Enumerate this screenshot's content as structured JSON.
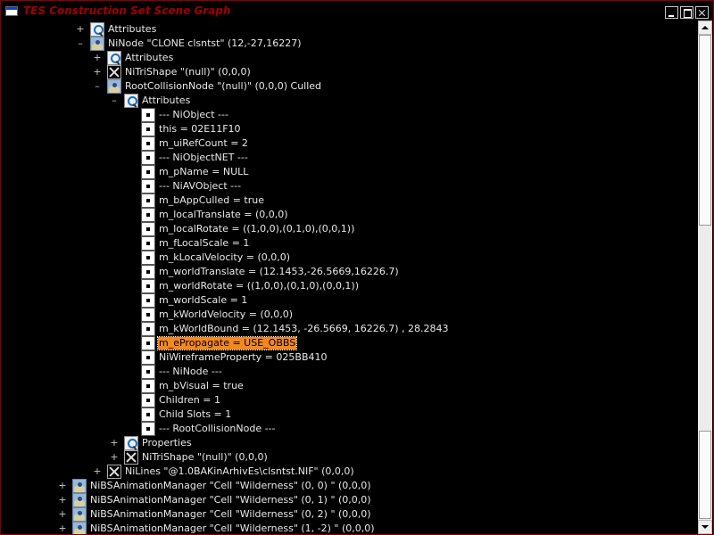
{
  "window": {
    "title": "TES Construction Set Scene Graph"
  },
  "tree": {
    "rows": [
      {
        "expander": "+",
        "icon": "attributes-icon",
        "label": "Attributes",
        "depth": 0
      },
      {
        "expander": "–",
        "icon": "node-icon",
        "label": "NiNode \"CLONE clsntst\" (12,-27,16227)",
        "depth": 0
      },
      {
        "expander": "+",
        "icon": "attributes-icon",
        "label": "Attributes",
        "depth": 1
      },
      {
        "expander": "+",
        "icon": "shape-icon",
        "label": "NiTriShape \"(null)\" (0,0,0)",
        "depth": 1
      },
      {
        "expander": "–",
        "icon": "node-icon",
        "label": "RootCollisionNode \"(null)\" (0,0,0) Culled",
        "depth": 1
      },
      {
        "expander": "–",
        "icon": "attributes-icon",
        "label": "Attributes",
        "depth": 2
      },
      {
        "expander": "",
        "icon": "field-icon",
        "label": "--- NiObject ---",
        "depth": 3
      },
      {
        "expander": "",
        "icon": "field-icon",
        "label": "this = 02E11F10",
        "depth": 3
      },
      {
        "expander": "",
        "icon": "field-icon",
        "label": "m_uiRefCount = 2",
        "depth": 3
      },
      {
        "expander": "",
        "icon": "field-icon",
        "label": "--- NiObjectNET ---",
        "depth": 3
      },
      {
        "expander": "",
        "icon": "field-icon",
        "label": "m_pName = NULL",
        "depth": 3
      },
      {
        "expander": "",
        "icon": "field-icon",
        "label": "--- NiAVObject ---",
        "depth": 3
      },
      {
        "expander": "",
        "icon": "field-icon",
        "label": "m_bAppCulled = true",
        "depth": 3
      },
      {
        "expander": "",
        "icon": "field-icon",
        "label": "m_localTranslate = (0,0,0)",
        "depth": 3
      },
      {
        "expander": "",
        "icon": "field-icon",
        "label": "m_localRotate = ((1,0,0),(0,1,0),(0,0,1))",
        "depth": 3
      },
      {
        "expander": "",
        "icon": "field-icon",
        "label": "m_fLocalScale = 1",
        "depth": 3
      },
      {
        "expander": "",
        "icon": "field-icon",
        "label": "m_kLocalVelocity = (0,0,0)",
        "depth": 3
      },
      {
        "expander": "",
        "icon": "field-icon",
        "label": "m_worldTranslate = (12.1453,-26.5669,16226.7)",
        "depth": 3
      },
      {
        "expander": "",
        "icon": "field-icon",
        "label": "m_worldRotate = ((1,0,0),(0,1,0),(0,0,1))",
        "depth": 3
      },
      {
        "expander": "",
        "icon": "field-icon",
        "label": "m_worldScale = 1",
        "depth": 3
      },
      {
        "expander": "",
        "icon": "field-icon",
        "label": "m_kWorldVelocity = (0,0,0)",
        "depth": 3
      },
      {
        "expander": "",
        "icon": "field-icon",
        "label": "m_kWorldBound = (12.1453, -26.5669, 16226.7) , 28.2843",
        "depth": 3
      },
      {
        "expander": "",
        "icon": "field-icon",
        "label": "m_ePropagate = USE_OBBS",
        "depth": 3,
        "selected": true
      },
      {
        "expander": "",
        "icon": "field-icon",
        "label": "NiWireframeProperty = 025BB410",
        "depth": 3
      },
      {
        "expander": "",
        "icon": "field-icon",
        "label": "--- NiNode ---",
        "depth": 3
      },
      {
        "expander": "",
        "icon": "field-icon",
        "label": "m_bVisual = true",
        "depth": 3
      },
      {
        "expander": "",
        "icon": "field-icon",
        "label": "Children = 1",
        "depth": 3
      },
      {
        "expander": "",
        "icon": "field-icon",
        "label": "Child Slots = 1",
        "depth": 3
      },
      {
        "expander": "",
        "icon": "field-icon",
        "label": "--- RootCollisionNode ---",
        "depth": 3
      },
      {
        "expander": "+",
        "icon": "attributes-icon",
        "label": "Properties",
        "depth": 2
      },
      {
        "expander": "+",
        "icon": "shape-icon",
        "label": "NiTriShape \"(null)\" (0,0,0)",
        "depth": 2
      },
      {
        "expander": "+",
        "icon": "shape-icon",
        "label": "NiLines \"@1.0BAKinArhivEs\\clsntst.NIF\" (0,0,0)",
        "depth": 1
      },
      {
        "expander": "+",
        "icon": "node-icon",
        "label": "NiBSAnimationManager \"Cell \"Wilderness\" (0, 0) \" (0,0,0)",
        "depth": -1
      },
      {
        "expander": "+",
        "icon": "node-icon",
        "label": "NiBSAnimationManager \"Cell \"Wilderness\" (0, 1) \" (0,0,0)",
        "depth": -1
      },
      {
        "expander": "+",
        "icon": "node-icon",
        "label": "NiBSAnimationManager \"Cell \"Wilderness\" (0, 2) \" (0,0,0)",
        "depth": -1
      },
      {
        "expander": "+",
        "icon": "node-icon",
        "label": "NiBSAnimationManager \"Cell \"Wilderness\" (1, -2) \" (0,0,0)",
        "depth": -1
      }
    ]
  }
}
